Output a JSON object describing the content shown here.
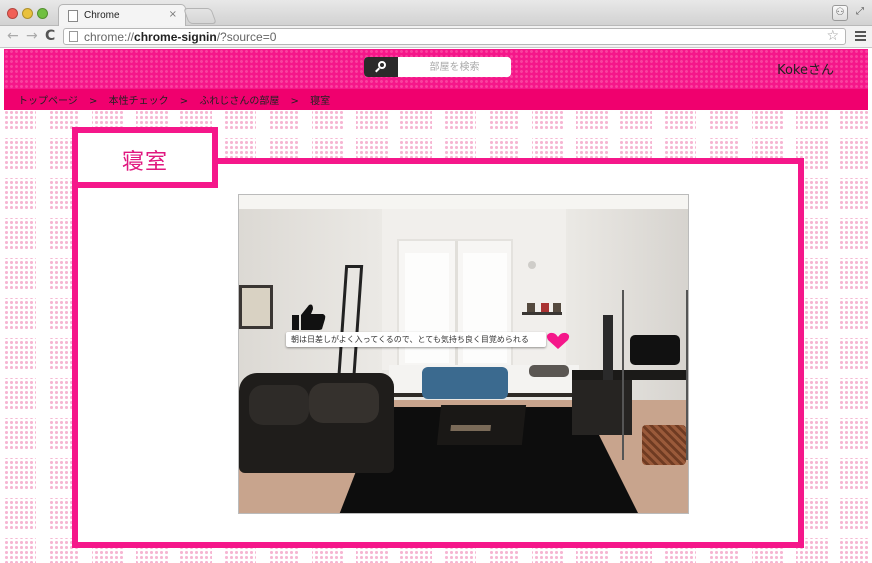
{
  "browser": {
    "tab_title": "Chrome",
    "tab_close": "×",
    "url_scheme": "chrome://",
    "url_host": "chrome-signin",
    "url_path": "/?source=0"
  },
  "header": {
    "search_placeholder": "部屋を検索",
    "username": "Kokeさん",
    "colors": {
      "header": "#f5178a",
      "breadcrumb": "#f0006e",
      "accent": "#e0177f"
    }
  },
  "breadcrumb": {
    "items": [
      "トップページ",
      "本性チェック",
      "ふれじさんの部屋",
      "寝室"
    ],
    "separator": ">"
  },
  "room": {
    "title": "寝室",
    "comment": "朝は日差しがよく入ってくるので、とても気持ち良く目覚められる"
  },
  "icons": [
    "search-icon",
    "thumbs-up-icon",
    "heart-icon",
    "star-icon",
    "menu-icon",
    "page-icon"
  ]
}
